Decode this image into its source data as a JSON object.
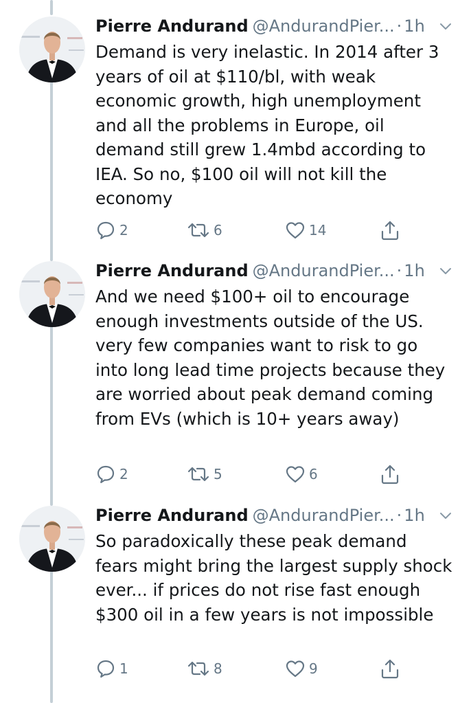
{
  "thread": {
    "tweets": [
      {
        "author_name": "Pierre Andurand",
        "handle": "@AndurandPier...",
        "dot": "·",
        "time": "1h",
        "text": "Demand is very inelastic. In 2014 after 3 years of oil at $110/bl, with weak economic growth, high unemployment and all the problems in Europe, oil demand still grew 1.4mbd according to IEA. So no, $100 oil will not kill the economy",
        "replies": "2",
        "retweets": "6",
        "likes": "14"
      },
      {
        "author_name": "Pierre Andurand",
        "handle": "@AndurandPier...",
        "dot": "·",
        "time": "1h",
        "text": "And we need $100+ oil to encourage enough investments outside of the US. very few companies want to risk to go into long lead time projects because they are worried about peak demand coming from EVs (which is 10+ years away)",
        "replies": "2",
        "retweets": "5",
        "likes": "6"
      },
      {
        "author_name": "Pierre Andurand",
        "handle": "@AndurandPier...",
        "dot": "·",
        "time": "1h",
        "text": "So paradoxically these peak demand fears might bring the largest supply shock ever... if prices do not rise fast enough $300 oil in a few years is not impossible",
        "replies": "1",
        "retweets": "8",
        "likes": "9"
      }
    ]
  },
  "colors": {
    "text": "#14171a",
    "secondary": "#657786",
    "thread_line": "#c4cfd6"
  },
  "icons": {
    "reply": "reply-icon",
    "retweet": "retweet-icon",
    "like": "heart-icon",
    "share": "share-icon",
    "menu": "chevron-down-icon"
  }
}
